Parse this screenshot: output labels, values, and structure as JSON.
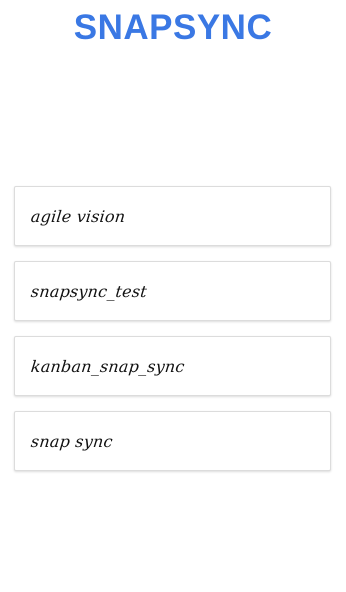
{
  "header": {
    "title": "SNAPSYNC"
  },
  "boards": [
    {
      "label": "agile vision"
    },
    {
      "label": "snapsync_test"
    },
    {
      "label": "kanban_snap_sync"
    },
    {
      "label": "snap sync"
    }
  ],
  "colors": {
    "title": "#3a78e4",
    "card_border": "#dcdcdc",
    "background": "#ffffff"
  }
}
